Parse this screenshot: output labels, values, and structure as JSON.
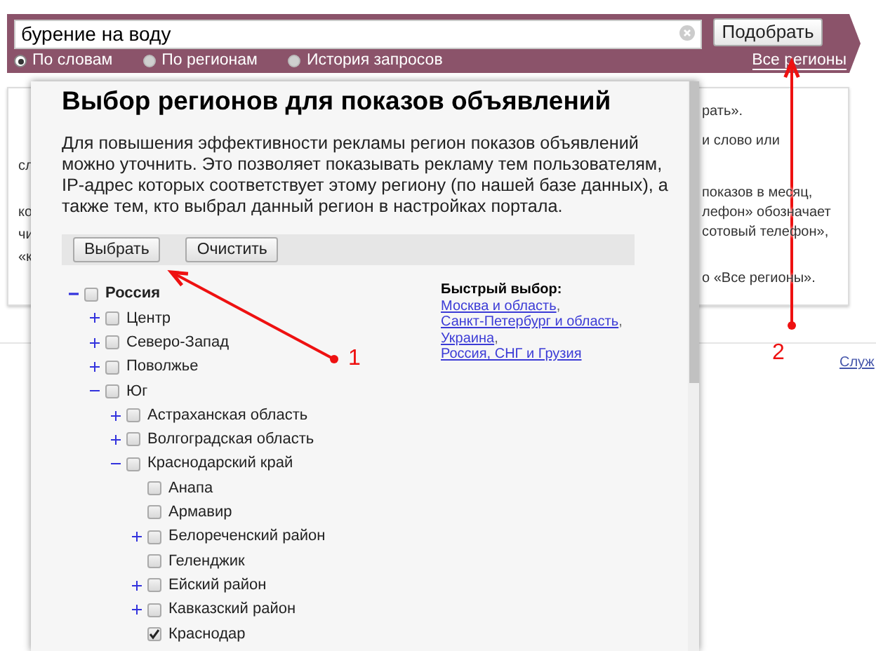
{
  "search": {
    "value": "бурение на воду",
    "submit": "Подобрать",
    "modes": [
      {
        "label": "По словам",
        "selected": true
      },
      {
        "label": "По регионам",
        "selected": false
      },
      {
        "label": "История запросов",
        "selected": false
      }
    ],
    "regions_link": "Все регионы"
  },
  "background": {
    "left_fragments": [
      "сл",
      "ко",
      "чи",
      "«к"
    ],
    "right_fragments": [
      "рать».",
      "и слово или",
      "показов в месяц,",
      "лефон» обозначает",
      "сотовый телефон»,",
      "о «Все регионы»."
    ],
    "footer_link": "Служ"
  },
  "dialog": {
    "title": "Выбор регионов для показов объявлений",
    "description": "Для повышения эффективности рекламы регион показов объявлений можно уточнить. Это позволяет показывать рекламу тем пользователям, IP-адрес которых соответствует этому региону (по нашей базе данных), а также тем, кто выбрал данный регион в настройках портала.",
    "buttons": [
      "Выбрать",
      "Очистить"
    ],
    "tree": [
      {
        "label": "Россия",
        "checked": false,
        "expanded": true,
        "children": [
          {
            "label": "Центр",
            "checked": false,
            "expanded": false
          },
          {
            "label": "Северо-Запад",
            "checked": false,
            "expanded": false
          },
          {
            "label": "Поволжье",
            "checked": false,
            "expanded": false
          },
          {
            "label": "Юг",
            "checked": false,
            "expanded": true,
            "children": [
              {
                "label": "Астраханская область",
                "checked": false,
                "expanded": false
              },
              {
                "label": "Волгоградская область",
                "checked": false,
                "expanded": false
              },
              {
                "label": "Краснодарский край",
                "checked": false,
                "expanded": true,
                "children": [
                  {
                    "label": "Анапа",
                    "checked": false
                  },
                  {
                    "label": "Армавир",
                    "checked": false
                  },
                  {
                    "label": "Белореченский район",
                    "checked": false,
                    "expanded": false
                  },
                  {
                    "label": "Геленджик",
                    "checked": false
                  },
                  {
                    "label": "Ейский район",
                    "checked": false,
                    "expanded": false
                  },
                  {
                    "label": "Кавказский район",
                    "checked": false,
                    "expanded": false
                  },
                  {
                    "label": "Краснодар",
                    "checked": true
                  }
                ]
              }
            ]
          }
        ]
      }
    ],
    "quick_select": {
      "title": "Быстрый выбор:",
      "links": [
        {
          "label": "Москва и область",
          "separator": ","
        },
        {
          "label": "Санкт-Петербург и область",
          "separator": ","
        },
        {
          "label": "Украина",
          "separator": ","
        },
        {
          "label": "Россия, СНГ и Грузия"
        }
      ]
    }
  },
  "annotations": [
    {
      "label": "1"
    },
    {
      "label": "2"
    }
  ]
}
